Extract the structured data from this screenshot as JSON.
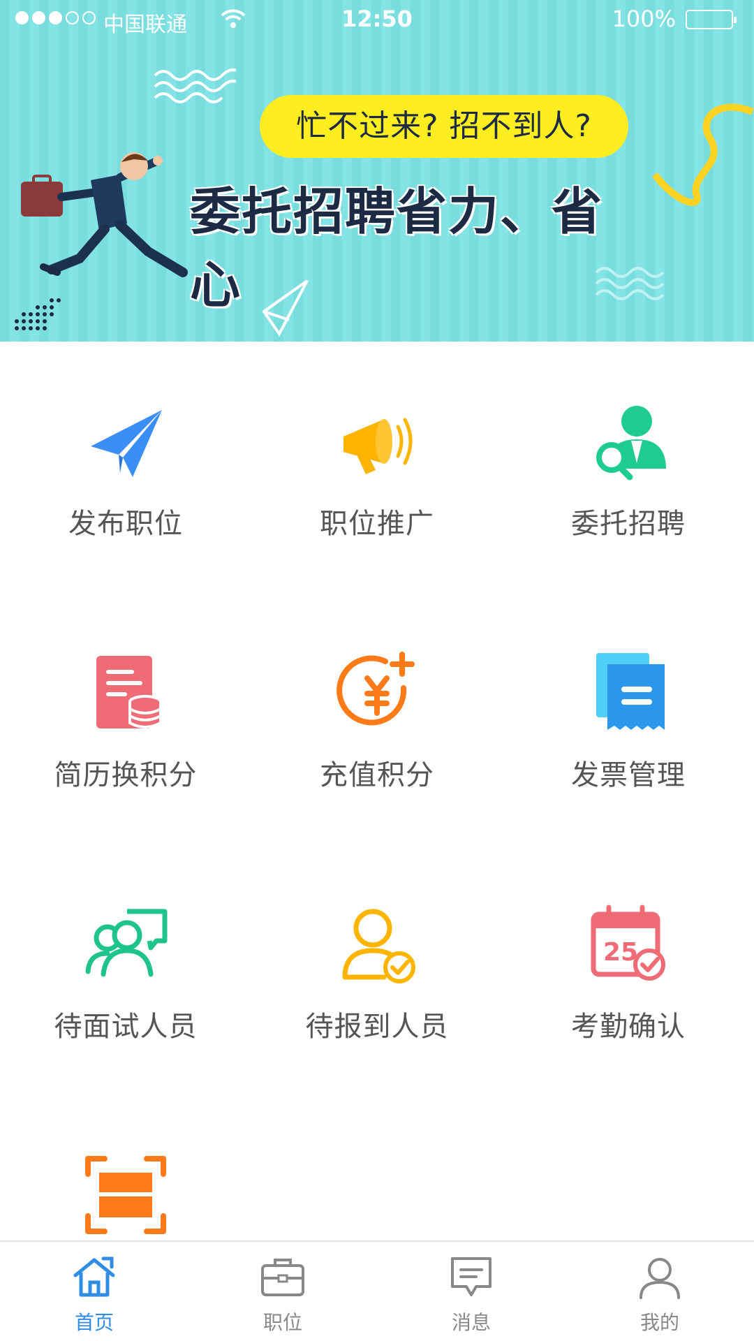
{
  "status_bar": {
    "carrier": "中国联通",
    "time": "12:50",
    "battery": "100%",
    "signal_bars_filled": 3,
    "signal_bars_total": 5
  },
  "banner": {
    "question": "忙不过来?  招不到人?",
    "slogan": "委托招聘省力、省心"
  },
  "menu": {
    "items": [
      {
        "label": "发布职位",
        "icon": "paper-plane-icon",
        "color": "#3a8ef6"
      },
      {
        "label": "职位推广",
        "icon": "megaphone-icon",
        "color": "#ffb400"
      },
      {
        "label": "委托招聘",
        "icon": "recruiter-search-icon",
        "color": "#1fcc8f"
      },
      {
        "label": "简历换积分",
        "icon": "resume-coins-icon",
        "color": "#ef6b75"
      },
      {
        "label": "充值积分",
        "icon": "yuan-coin-plus-icon",
        "color": "#ff7a18"
      },
      {
        "label": "发票管理",
        "icon": "invoice-icon",
        "color": "#28a8f0"
      },
      {
        "label": "待面试人员",
        "icon": "interview-people-icon",
        "color": "#1fc48a"
      },
      {
        "label": "待报到人员",
        "icon": "user-check-icon",
        "color": "#ffb400"
      },
      {
        "label": "考勤确认",
        "icon": "calendar-check-icon",
        "color": "#ef6b75"
      },
      {
        "label": "",
        "icon": "scan-icon",
        "color": "#ff7a18"
      }
    ]
  },
  "tabbar": {
    "tabs": [
      {
        "label": "首页",
        "icon": "home-icon",
        "active": true
      },
      {
        "label": "职位",
        "icon": "briefcase-icon",
        "active": false
      },
      {
        "label": "消息",
        "icon": "message-icon",
        "active": false
      },
      {
        "label": "我的",
        "icon": "person-icon",
        "active": false
      }
    ],
    "active_color": "#2f8de4",
    "inactive_color": "#888888"
  }
}
